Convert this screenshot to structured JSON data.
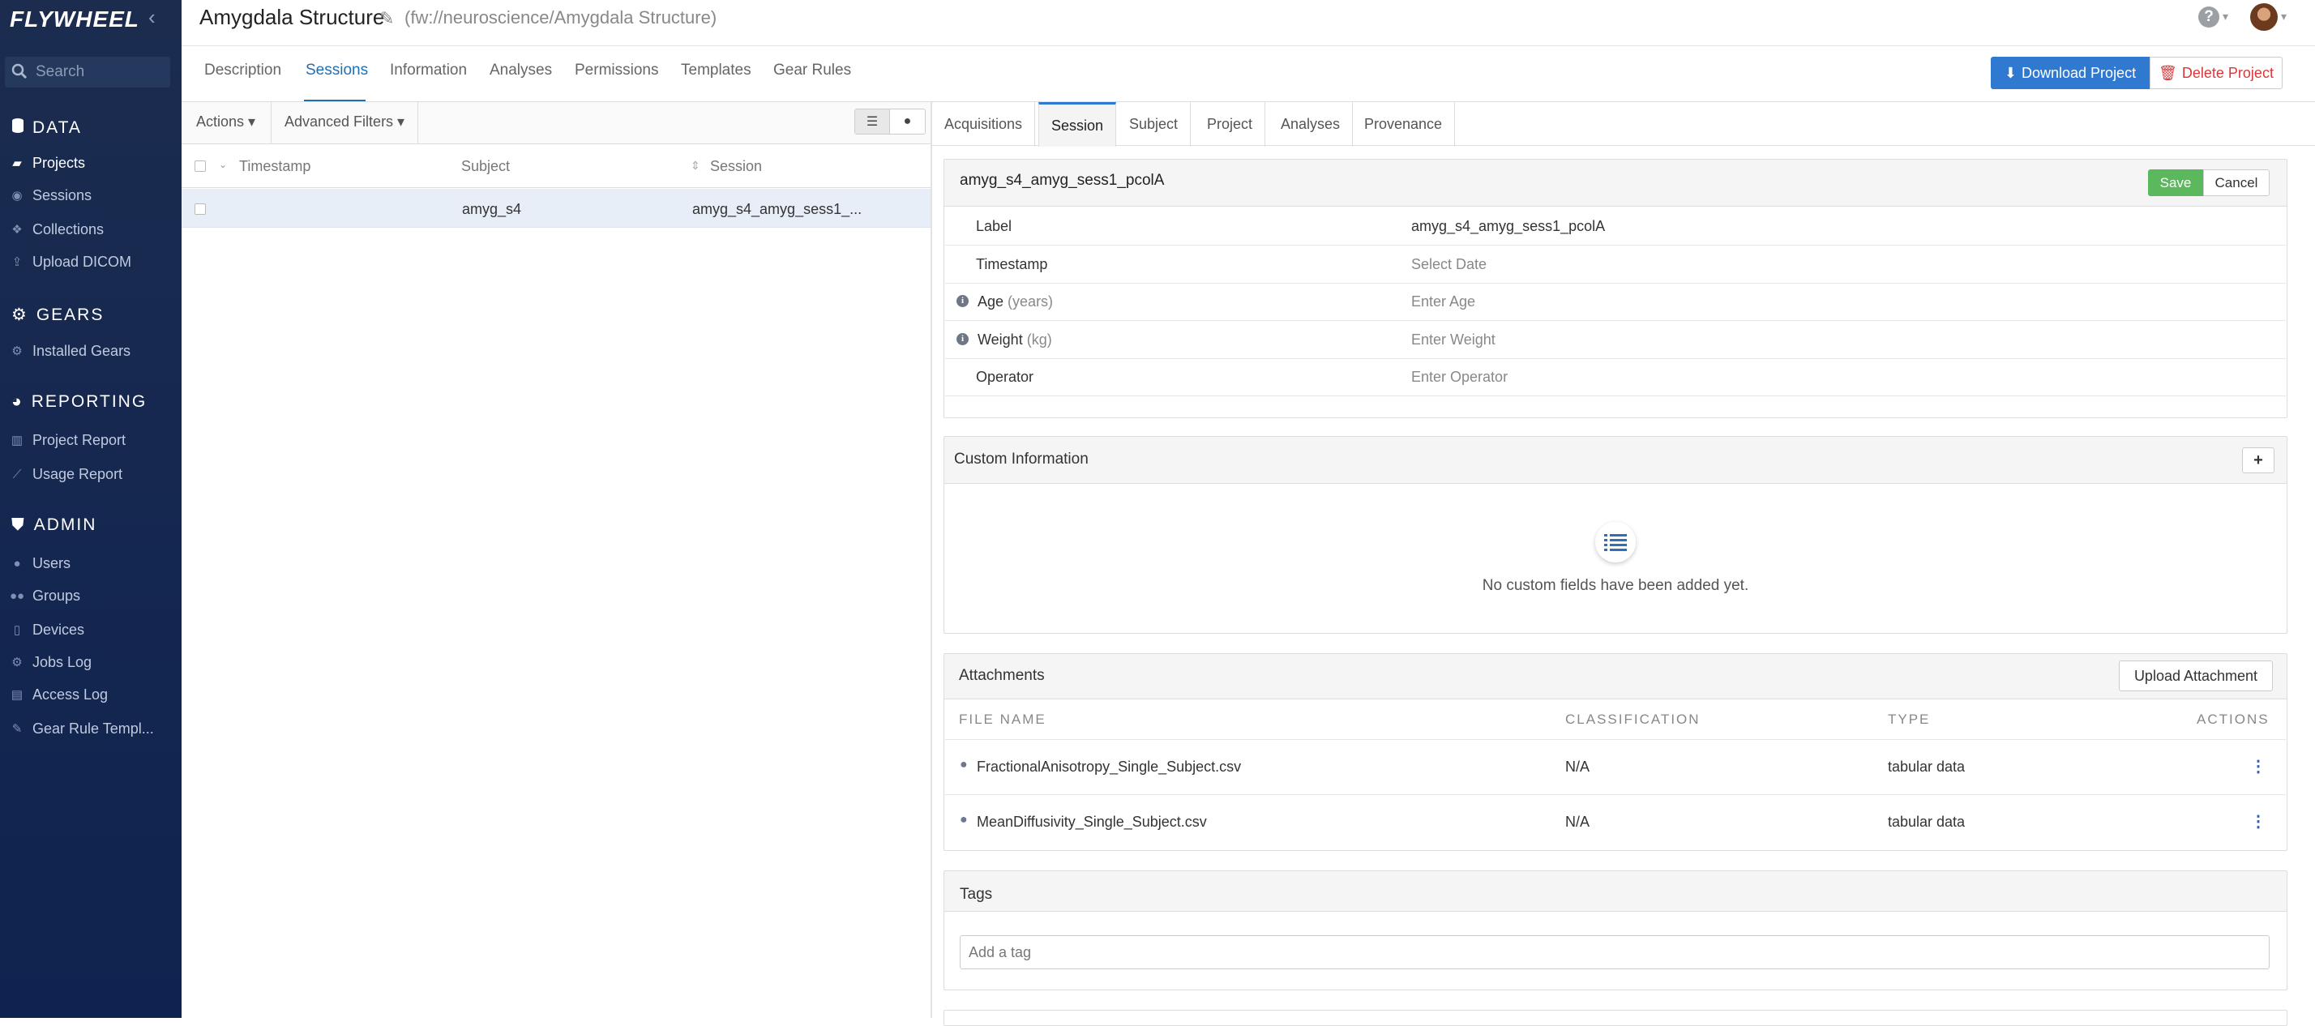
{
  "app": {
    "logo": "FLYWHEEL",
    "collapse_glyph": "‹",
    "search_placeholder": "Search"
  },
  "sidebar": {
    "sections": [
      {
        "title": "DATA",
        "icon": "database-icon",
        "items": [
          {
            "label": "Projects",
            "icon": "folder-open-icon",
            "active": true
          },
          {
            "label": "Sessions",
            "icon": "sessions-icon"
          },
          {
            "label": "Collections",
            "icon": "collections-icon"
          },
          {
            "label": "Upload DICOM",
            "icon": "upload-icon"
          }
        ]
      },
      {
        "title": "GEARS",
        "icon": "gear-icon",
        "items": [
          {
            "label": "Installed Gears",
            "icon": "gear-icon"
          }
        ]
      },
      {
        "title": "REPORTING",
        "icon": "pie-chart-icon",
        "items": [
          {
            "label": "Project Report",
            "icon": "bar-chart-icon"
          },
          {
            "label": "Usage Report",
            "icon": "line-chart-icon"
          }
        ]
      },
      {
        "title": "ADMIN",
        "icon": "shield-icon",
        "items": [
          {
            "label": "Users",
            "icon": "user-icon"
          },
          {
            "label": "Groups",
            "icon": "users-icon"
          },
          {
            "label": "Devices",
            "icon": "device-icon"
          },
          {
            "label": "Jobs Log",
            "icon": "cogs-icon"
          },
          {
            "label": "Access Log",
            "icon": "file-icon"
          },
          {
            "label": "Gear Rule Templ...",
            "icon": "wrench-icon"
          }
        ]
      }
    ]
  },
  "header": {
    "title": "Amygdala Structure",
    "path": "(fw://neuroscience/Amygdala Structure)",
    "help_glyph": "?",
    "caret": "▾"
  },
  "project_tabs": [
    {
      "label": "Description"
    },
    {
      "label": "Sessions",
      "active": true
    },
    {
      "label": "Information"
    },
    {
      "label": "Analyses"
    },
    {
      "label": "Permissions"
    },
    {
      "label": "Templates"
    },
    {
      "label": "Gear Rules"
    }
  ],
  "project_actions": {
    "download": "Download Project",
    "delete": "Delete Project"
  },
  "session_list": {
    "toolbar": {
      "actions": "Actions ▾",
      "filters": "Advanced Filters ▾"
    },
    "columns": [
      "Timestamp",
      "Subject",
      "Session"
    ],
    "rows": [
      {
        "timestamp": "",
        "subject": "amyg_s4",
        "session": "amyg_s4_amyg_sess1_..."
      }
    ]
  },
  "detail_tabs": [
    {
      "label": "Acquisitions"
    },
    {
      "label": "Session",
      "active": true
    },
    {
      "label": "Subject"
    },
    {
      "label": "Project"
    },
    {
      "label": "Analyses"
    },
    {
      "label": "Provenance"
    }
  ],
  "session": {
    "title": "amyg_s4_amyg_sess1_pcolA",
    "save": "Save",
    "cancel": "Cancel",
    "fields": [
      {
        "label": "Label",
        "hint": "",
        "value": "amyg_s4_amyg_sess1_pcolA",
        "placeholder": ""
      },
      {
        "label": "Timestamp",
        "hint": "",
        "value": "",
        "placeholder": "Select Date"
      },
      {
        "label": "Age",
        "hint": "(years)",
        "value": "",
        "placeholder": "Enter Age"
      },
      {
        "label": "Weight",
        "hint": "(kg)",
        "value": "",
        "placeholder": "Enter Weight"
      },
      {
        "label": "Operator",
        "hint": "",
        "value": "",
        "placeholder": "Enter Operator"
      }
    ]
  },
  "custom_info": {
    "title": "Custom Information",
    "add": "+",
    "empty": "No custom fields have been added yet."
  },
  "attachments": {
    "title": "Attachments",
    "upload": "Upload Attachment",
    "columns": [
      "FILE NAME",
      "CLASSIFICATION",
      "TYPE",
      "ACTIONS"
    ],
    "files": [
      {
        "name": "FractionalAnisotropy_Single_Subject.csv",
        "classification": "N/A",
        "type": "tabular data"
      },
      {
        "name": "MeanDiffusivity_Single_Subject.csv",
        "classification": "N/A",
        "type": "tabular data"
      }
    ]
  },
  "tags": {
    "title": "Tags",
    "placeholder": "Add a tag"
  }
}
